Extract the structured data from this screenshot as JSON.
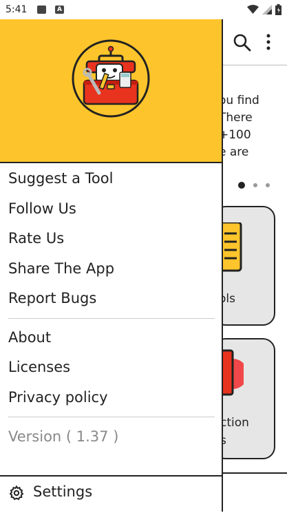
{
  "status_bar": {
    "time": "5:41"
  },
  "background": {
    "intro_lines": [
      "ou find",
      "There",
      "+100",
      "e are"
    ],
    "card1_label": "ols",
    "card2_label_lines": [
      "ction",
      "s"
    ]
  },
  "drawer": {
    "menu_group_1": [
      "Suggest a Tool",
      "Follow Us",
      "Rate Us",
      "Share The App",
      "Report Bugs"
    ],
    "menu_group_2": [
      "About",
      "Licenses",
      "Privacy policy"
    ],
    "version": "Version ( 1.37 )",
    "settings_label": "Settings"
  },
  "colors": {
    "header_yellow": "#fdc52b",
    "toolbox_red": "#e8331f"
  }
}
